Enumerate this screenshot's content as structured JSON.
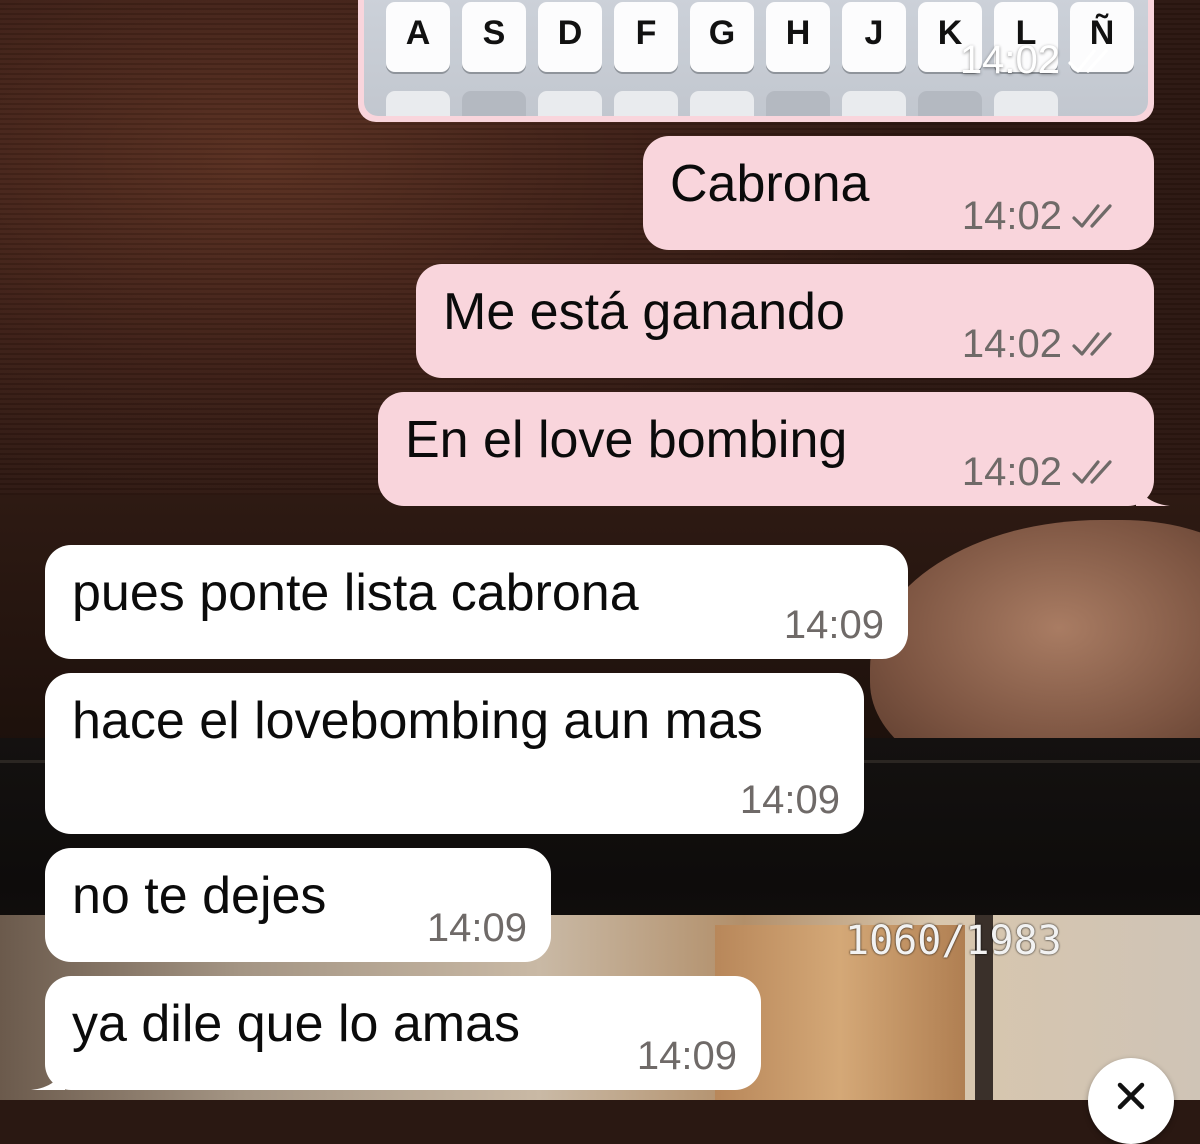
{
  "keyboard_image": {
    "keys": [
      "A",
      "S",
      "D",
      "F",
      "G",
      "H",
      "J",
      "K",
      "L",
      "Ñ"
    ],
    "time": "14:02",
    "status_icon": "double-check-icon"
  },
  "messages": [
    {
      "direction": "outgoing",
      "text": "Cabrona",
      "time": "14:02",
      "status_icon": "double-check-icon"
    },
    {
      "direction": "outgoing",
      "text": "Me está ganando",
      "time": "14:02",
      "status_icon": "double-check-icon"
    },
    {
      "direction": "outgoing",
      "text": "En el love bombing",
      "time": "14:02",
      "status_icon": "double-check-icon"
    },
    {
      "direction": "incoming",
      "text": "pues ponte lista cabrona",
      "time": "14:09"
    },
    {
      "direction": "incoming",
      "text": "hace el lovebombing aun mas",
      "time": "14:09"
    },
    {
      "direction": "incoming",
      "text": "no te dejes",
      "time": "14:09"
    },
    {
      "direction": "incoming",
      "text": "ya dile que lo amas",
      "time": "14:09"
    }
  ],
  "wallpaper": {
    "counter_text": "1060/1983"
  },
  "controls": {
    "close_icon": "close-icon"
  },
  "colors": {
    "outgoing_bubble": "#f9d5dc",
    "incoming_bubble": "#ffffff",
    "meta_text": "#6f6a68"
  }
}
